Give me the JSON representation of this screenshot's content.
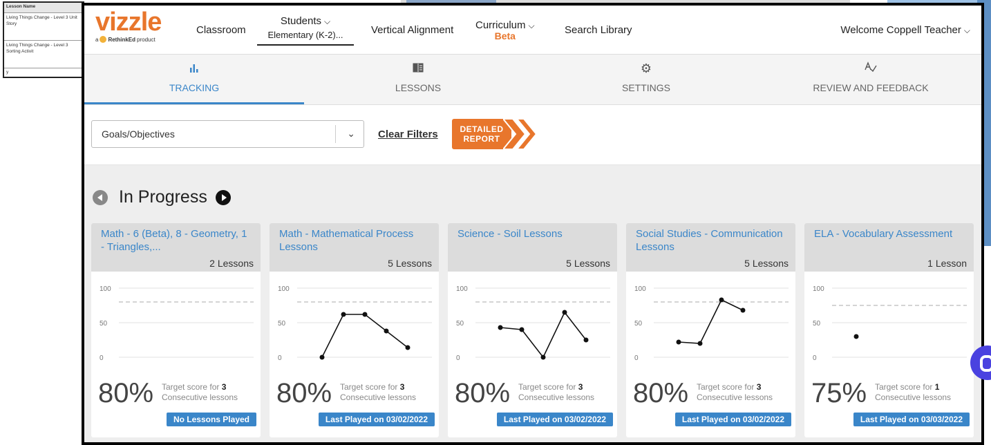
{
  "background": {
    "table": {
      "header": "Lesson Name",
      "rows": [
        "Living Things Change - Level 3 Unit Story",
        "Living Things Change - Level 3 Sorting Activit"
      ],
      "trailing": "y"
    }
  },
  "app": {
    "logo": "vizzle",
    "logo_sub_prefix": "a",
    "logo_sub_brand": "RethinkEd",
    "logo_sub_suffix": "product"
  },
  "nav": {
    "classroom": "Classroom",
    "students": "Students",
    "students_selected": "Elementary (K-2)...",
    "vertical_alignment": "Vertical Alignment",
    "curriculum": "Curriculum",
    "curriculum_badge": "Beta",
    "search_library": "Search Library",
    "welcome": "Welcome Coppell Teacher"
  },
  "tabs": [
    {
      "label": "TRACKING",
      "icon": "bar-chart-icon",
      "active": true
    },
    {
      "label": "LESSONS",
      "icon": "book-icon",
      "active": false
    },
    {
      "label": "SETTINGS",
      "icon": "gear-icon",
      "active": false
    },
    {
      "label": "REVIEW AND FEEDBACK",
      "icon": "spellcheck-icon",
      "active": false
    }
  ],
  "filters": {
    "select_value": "Goals/Objectives",
    "clear_label": "Clear Filters",
    "detailed_line1": "DETAILED",
    "detailed_line2": "REPORT"
  },
  "section": {
    "title": "In Progress"
  },
  "colors": {
    "accent": "#3a86c9",
    "brand": "#e8762c"
  },
  "cards": [
    {
      "title": "Math - 6 (Beta), 8 - Geometry, 1 - Triangles,...",
      "count": "2 Lessons",
      "percent": "80%",
      "target_prefix": "Target score for",
      "target_num": "3",
      "target_suffix": "Consecutive lessons",
      "status": "No Lessons Played",
      "points": [],
      "target_value": 80
    },
    {
      "title": "Math - Mathematical Process Lessons",
      "count": "5 Lessons",
      "percent": "80%",
      "target_prefix": "Target score for",
      "target_num": "3",
      "target_suffix": "Consecutive lessons",
      "status": "Last Played on 03/02/2022",
      "points": [
        0,
        62,
        62,
        38,
        14
      ],
      "target_value": 80
    },
    {
      "title": "Science - Soil Lessons",
      "count": "5 Lessons",
      "percent": "80%",
      "target_prefix": "Target score for",
      "target_num": "3",
      "target_suffix": "Consecutive lessons",
      "status": "Last Played on 03/02/2022",
      "points": [
        43,
        40,
        0,
        65,
        25
      ],
      "target_value": 80
    },
    {
      "title": "Social Studies - Communication Lessons",
      "count": "5 Lessons",
      "percent": "80%",
      "target_prefix": "Target score for",
      "target_num": "3",
      "target_suffix": "Consecutive lessons",
      "status": "Last Played on 03/02/2022",
      "points": [
        22,
        20,
        83,
        68
      ],
      "target_value": 80
    },
    {
      "title": "ELA - Vocabulary Assessment",
      "count": "1 Lesson",
      "percent": "75%",
      "target_prefix": "Target score for",
      "target_num": "1",
      "target_suffix": "Consecutive lessons",
      "status": "Last Played on 03/03/2022",
      "points": [
        30
      ],
      "target_value": 75
    }
  ],
  "chart_data": [
    {
      "type": "line",
      "title": "Math - 6 (Beta), 8 - Geometry, 1 - Triangles,...",
      "y_ticks": [
        0,
        50,
        100
      ],
      "ylim": [
        0,
        100
      ],
      "target": 80,
      "series": [
        {
          "values": []
        }
      ]
    },
    {
      "type": "line",
      "title": "Math - Mathematical Process Lessons",
      "y_ticks": [
        0,
        50,
        100
      ],
      "ylim": [
        0,
        100
      ],
      "target": 80,
      "series": [
        {
          "values": [
            0,
            62,
            62,
            38,
            14
          ]
        }
      ]
    },
    {
      "type": "line",
      "title": "Science - Soil Lessons",
      "y_ticks": [
        0,
        50,
        100
      ],
      "ylim": [
        0,
        100
      ],
      "target": 80,
      "series": [
        {
          "values": [
            43,
            40,
            0,
            65,
            25
          ]
        }
      ]
    },
    {
      "type": "line",
      "title": "Social Studies - Communication Lessons",
      "y_ticks": [
        0,
        50,
        100
      ],
      "ylim": [
        0,
        100
      ],
      "target": 80,
      "series": [
        {
          "values": [
            22,
            20,
            83,
            68
          ]
        }
      ]
    },
    {
      "type": "line",
      "title": "ELA - Vocabulary Assessment",
      "y_ticks": [
        0,
        50,
        100
      ],
      "ylim": [
        0,
        100
      ],
      "target": 75,
      "series": [
        {
          "values": [
            30
          ]
        }
      ]
    }
  ]
}
